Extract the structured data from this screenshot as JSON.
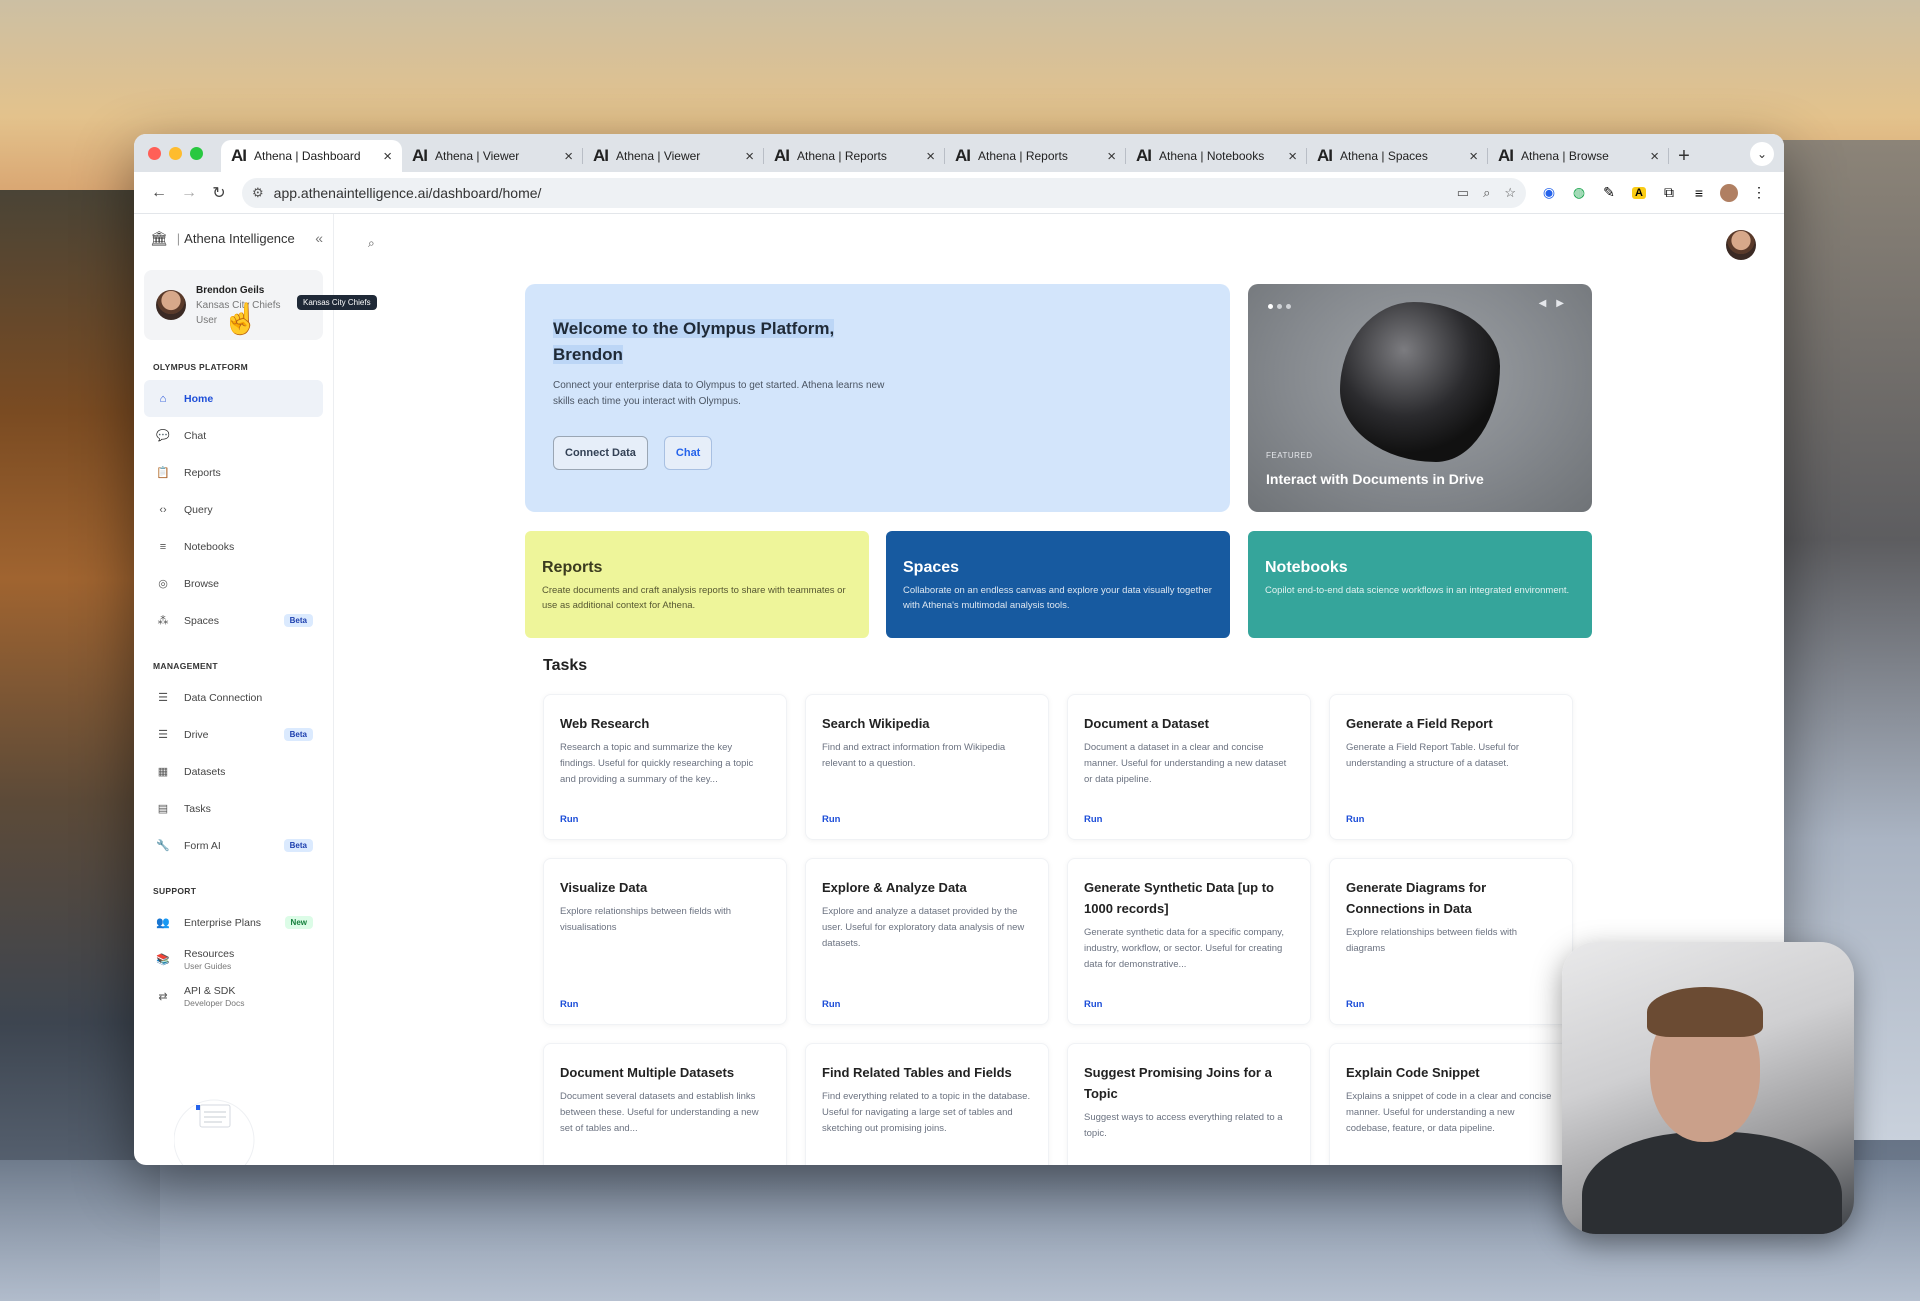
{
  "browser": {
    "tabs": [
      {
        "title": "Athena | Dashboard",
        "active": true
      },
      {
        "title": "Athena | Viewer"
      },
      {
        "title": "Athena | Viewer"
      },
      {
        "title": "Athena | Reports"
      },
      {
        "title": "Athena | Reports"
      },
      {
        "title": "Athena | Notebooks"
      },
      {
        "title": "Athena | Spaces"
      },
      {
        "title": "Athena | Browse"
      }
    ],
    "favicon": "AI",
    "url": "app.athenaintelligence.ai/dashboard/home/"
  },
  "sidebar": {
    "brand": "Athena Intelligence",
    "user": {
      "name": "Brendon Geils",
      "org": "Kansas City Chiefs",
      "role": "User",
      "tooltip": "Kansas City Chiefs"
    },
    "sections": [
      {
        "title": "OLYMPUS PLATFORM",
        "items": [
          {
            "label": "Home",
            "icon": "home-icon",
            "active": true
          },
          {
            "label": "Chat",
            "icon": "chat-icon"
          },
          {
            "label": "Reports",
            "icon": "clipboard-icon"
          },
          {
            "label": "Query",
            "icon": "code-icon"
          },
          {
            "label": "Notebooks",
            "icon": "lines-icon"
          },
          {
            "label": "Browse",
            "icon": "globe-search-icon"
          },
          {
            "label": "Spaces",
            "icon": "dots-icon",
            "badge": "Beta"
          }
        ]
      },
      {
        "title": "MANAGEMENT",
        "items": [
          {
            "label": "Data Connection",
            "icon": "list-icon"
          },
          {
            "label": "Drive",
            "icon": "list-icon",
            "badge": "Beta"
          },
          {
            "label": "Datasets",
            "icon": "table-icon"
          },
          {
            "label": "Tasks",
            "icon": "file-icon"
          },
          {
            "label": "Form AI",
            "icon": "wrench-icon",
            "badge": "Beta"
          }
        ]
      },
      {
        "title": "SUPPORT",
        "items": [
          {
            "label": "Enterprise Plans",
            "icon": "people-icon",
            "badge": "New"
          },
          {
            "label": "Resources",
            "sub": "User Guides",
            "icon": "book-icon"
          },
          {
            "label": "API & SDK",
            "sub": "Developer Docs",
            "icon": "http-icon"
          }
        ]
      }
    ]
  },
  "hero": {
    "title": "Welcome to the Olympus Platform, Brendon",
    "text": "Connect your enterprise data to Olympus to get started. Athena learns new skills each time you interact with Olympus.",
    "btn_connect": "Connect Data",
    "btn_chat": "Chat"
  },
  "featured": {
    "tag": "FEATURED",
    "title": "Interact with Documents in Drive"
  },
  "cards": [
    {
      "title": "Reports",
      "text": "Create documents and craft analysis reports to share with teammates or use as additional context for Athena."
    },
    {
      "title": "Spaces",
      "text": "Collaborate on an endless canvas and explore your data visually together with Athena's multimodal analysis tools."
    },
    {
      "title": "Notebooks",
      "text": "Copilot end-to-end data science workflows in an integrated environment."
    }
  ],
  "tasks_heading": "Tasks",
  "run_label": "Run",
  "tasks": [
    {
      "title": "Web Research",
      "text": "Research a topic and summarize the key findings. Useful for quickly researching a topic and providing a summary of the key..."
    },
    {
      "title": "Search Wikipedia",
      "text": "Find and extract information from Wikipedia relevant to a question."
    },
    {
      "title": "Document a Dataset",
      "text": "Document a dataset in a clear and concise manner. Useful for understanding a new dataset or data pipeline."
    },
    {
      "title": "Generate a Field Report",
      "text": "Generate a Field Report Table. Useful for understanding a structure of a dataset."
    },
    {
      "title": "Visualize Data",
      "text": "Explore relationships between fields with visualisations"
    },
    {
      "title": "Explore & Analyze Data",
      "text": "Explore and analyze a dataset provided by the user. Useful for exploratory data analysis of new datasets."
    },
    {
      "title": "Generate Synthetic Data [up to 1000 records]",
      "text": "Generate synthetic data for a specific company, industry, workflow, or sector. Useful for creating data for demonstrative..."
    },
    {
      "title": "Generate Diagrams for Connections in Data",
      "text": "Explore relationships between fields with diagrams"
    },
    {
      "title": "Document Multiple Datasets",
      "text": "Document several datasets and establish links between these. Useful for understanding a new set of tables and..."
    },
    {
      "title": "Find Related Tables and Fields",
      "text": "Find everything related to a topic in the database. Useful for navigating a large set of tables and sketching out promising joins."
    },
    {
      "title": "Suggest Promising Joins for a Topic",
      "text": "Suggest ways to access everything related to a topic."
    },
    {
      "title": "Explain Code Snippet",
      "text": "Explains a snippet of code in a clear and concise manner. Useful for understanding a new codebase, feature, or data pipeline."
    }
  ]
}
